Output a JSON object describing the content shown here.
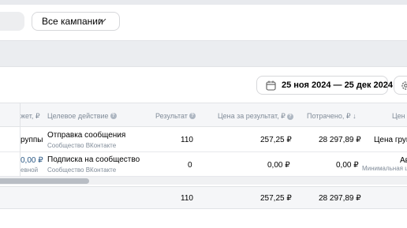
{
  "filters": {
    "campaign_select": "Все кампании"
  },
  "date_range": {
    "label": "25 ноя 2024 — 25 дек 2024"
  },
  "table": {
    "headers": {
      "budget": "жет, ₽",
      "target_action": "Целевое действие",
      "result": "Результат",
      "price_per_result": "Цена за результат, ₽",
      "spent": "Потрачено, ₽ ↓",
      "price": "Цен"
    },
    "rows": [
      {
        "budget": "руппы",
        "budget_sub": "",
        "action": "Отправка сообщения",
        "action_sub": "Сообщество ВКонтакте",
        "result": "110",
        "price_per_result": "257,25 ₽",
        "spent": "28 297,89 ₽",
        "price": "Цена груп",
        "price_sub": ""
      },
      {
        "budget": "0,00 ₽",
        "budget_sub": "евной",
        "action": "Подписка на сообщество",
        "action_sub": "Сообщество ВКонтакте",
        "result": "0",
        "price_per_result": "0,00 ₽",
        "spent": "0,00 ₽",
        "price": "Ав",
        "price_sub": "Минимальная ц"
      }
    ],
    "totals": {
      "result": "110",
      "price_per_result": "257,25 ₽",
      "spent": "28 297,89 ₽"
    }
  },
  "colors": {
    "accent": "#2a5885",
    "muted": "#818c99",
    "band": "#ebedf0"
  }
}
